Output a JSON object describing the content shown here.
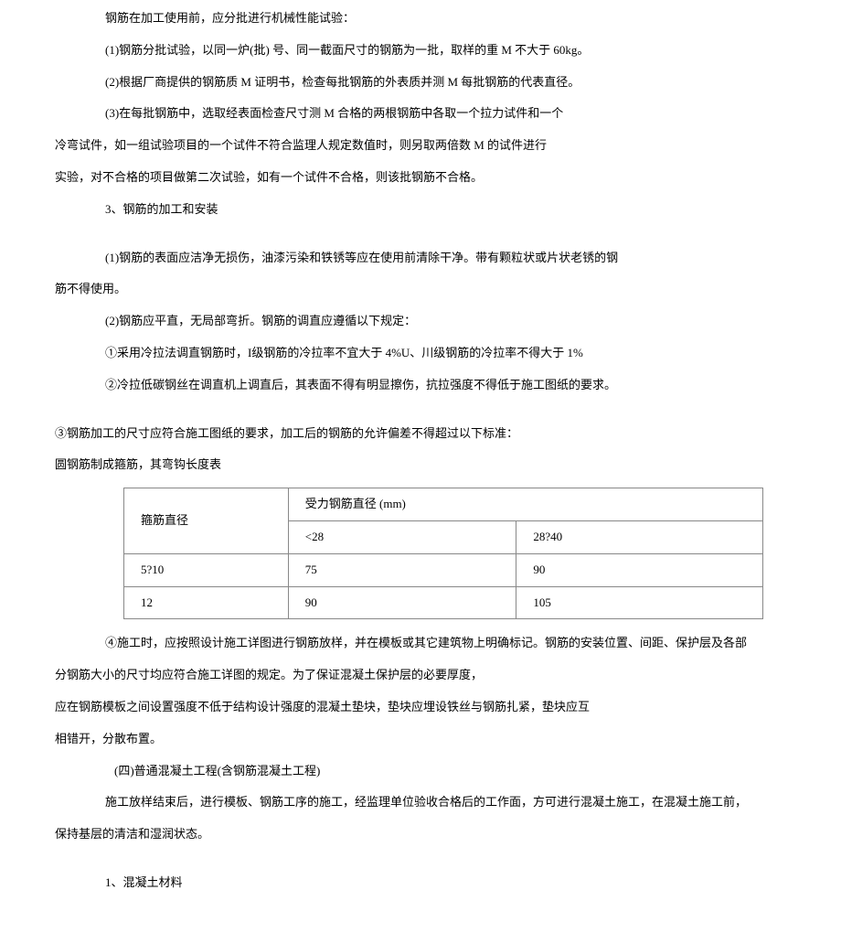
{
  "p1": "钢筋在加工使用前，应分批进行机械性能试验：",
  "p2": "(1)钢筋分批试验，以同一炉(批) 号、同一截面尺寸的钢筋为一批，取样的重 M 不大于 60kg。",
  "p3": "(2)根据厂商提供的钢筋质 M 证明书，检查每批钢筋的外表质并测 M 每批钢筋的代表直径。",
  "p4": "(3)在每批钢筋中，选取经表面检查尺寸测 M 合格的两根钢筋中各取一个拉力试件和一个",
  "p5": "冷弯试件，如一组试验项目的一个试件不符合监理人规定数值时，则另取两倍数 M 的试件进行",
  "p6": "实验，对不合格的项目做第二次试验，如有一个试件不合格，则该批钢筋不合格。",
  "p7": "3、钢筋的加工和安装",
  "p8": "(1)钢筋的表面应洁净无损伤，油漆污染和铁锈等应在使用前清除干净。带有颗粒状或片状老锈的钢",
  "p9": "筋不得使用。",
  "p10": "(2)钢筋应平直，无局部弯折。钢筋的调直应遵循以下规定：",
  "p11": "①采用冷拉法调直钢筋时，I级钢筋的冷拉率不宜大于 4%U、川级钢筋的冷拉率不得大于 1%",
  "p12": "②冷拉低碳钢丝在调直机上调直后，其表面不得有明显擦伤，抗拉强度不得低于施工图纸的要求。",
  "p13": "③钢筋加工的尺寸应符合施工图纸的要求，加工后的钢筋的允许偏差不得超过以下标准：",
  "p14": "圆钢筋制成箍筋，其弯钩长度表",
  "table": {
    "rowspan_header": "箍筋直径",
    "group_header": "受力钢筋直径 (mm)",
    "sub_header_1": "<28",
    "sub_header_2": "28?40",
    "row1": {
      "c1": "5?10",
      "c2": "75",
      "c3": "90"
    },
    "row2": {
      "c1": "12",
      "c2": "90",
      "c3": "105"
    }
  },
  "p15": "④施工时，应按照设计施工详图进行钢筋放样，并在模板或其它建筑物上明确标记。钢筋的安装位置、间距、保护层及各部",
  "p16": "分钢筋大小的尺寸均应符合施工详图的规定。为了保证混凝土保护层的必要厚度，",
  "p17": "应在钢筋模板之间设置强度不低于结构设计强度的混凝土垫块，垫块应埋设铁丝与钢筋扎紧，垫块应互",
  "p18": "相错开，分散布置。",
  "p19": "(四)普通混凝土工程(含钢筋混凝土工程)",
  "p20": "施工放样结束后，进行模板、钢筋工序的施工，经监理单位验收合格后的工作面，方可进行混凝土施工，在混凝土施工前，",
  "p21": "保持基层的清洁和湿润状态。",
  "p22": "1、混凝土材料"
}
